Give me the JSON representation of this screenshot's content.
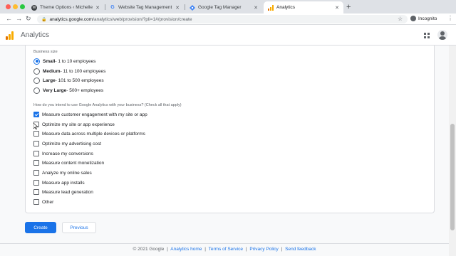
{
  "browser": {
    "tabs": [
      {
        "title": "Theme Options ‹ Michelle The",
        "favicon": "wordpress-icon",
        "active": false
      },
      {
        "title": "Website Tag Management Too",
        "favicon": "google-icon",
        "active": false
      },
      {
        "title": "Google Tag Manager",
        "favicon": "tag-manager-icon",
        "active": false
      },
      {
        "title": "Analytics",
        "favicon": "analytics-icon",
        "active": true
      }
    ],
    "newtab_label": "+",
    "url_domain": "analytics.google.com",
    "url_path": "/analytics/web/provision/?pli=1#/provision/create",
    "profile_label": "Incognito",
    "back_glyph": "←",
    "forward_glyph": "→",
    "reload_glyph": "↻",
    "lock_glyph": "🔒",
    "star_glyph": "☆",
    "menu_glyph": "⋮"
  },
  "app": {
    "name": "Analytics"
  },
  "form": {
    "business_size_label": "Business size",
    "business_sizes": [
      {
        "bold": "Small",
        "rest": " - 1 to 10 employees",
        "selected": true
      },
      {
        "bold": "Medium",
        "rest": " - 11 to 100 employees",
        "selected": false
      },
      {
        "bold": "Large",
        "rest": " - 101 to 500 employees",
        "selected": false
      },
      {
        "bold": "Very Large",
        "rest": " - 500+ employees",
        "selected": false
      }
    ],
    "intent_label": "How do you intend to use Google Analytics with your business? (Check all that apply)",
    "intents": [
      {
        "label": "Measure customer engagement with my site or app",
        "checked": true
      },
      {
        "label": "Optimize my site or app experience",
        "checked": false
      },
      {
        "label": "Measure data across multiple devices or platforms",
        "checked": false
      },
      {
        "label": "Optimize my advertising cost",
        "checked": false
      },
      {
        "label": "Increase my conversions",
        "checked": false
      },
      {
        "label": "Measure content monetization",
        "checked": false
      },
      {
        "label": "Analyze my online sales",
        "checked": false
      },
      {
        "label": "Measure app installs",
        "checked": false
      },
      {
        "label": "Measure lead generation",
        "checked": false
      },
      {
        "label": "Other",
        "checked": false
      }
    ],
    "create_label": "Create",
    "previous_label": "Previous"
  },
  "footer": {
    "copyright": "© 2021 Google",
    "links": [
      "Analytics home",
      "Terms of Service",
      "Privacy Policy",
      "Send feedback"
    ],
    "separator": "|"
  },
  "colors": {
    "accent": "#1a73e8",
    "logo_orange": "#f9ab00",
    "logo_dark_orange": "#e37400"
  }
}
